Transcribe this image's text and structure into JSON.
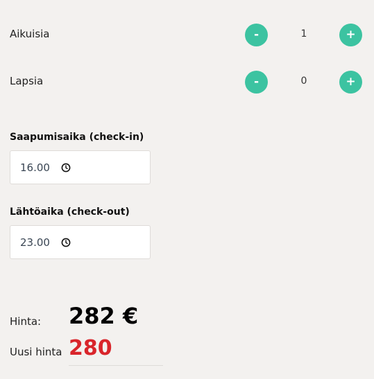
{
  "guests": {
    "adults": {
      "label": "Aikuisia",
      "value": "1",
      "minus": "-",
      "plus": "+"
    },
    "children": {
      "label": "Lapsia",
      "value": "0",
      "minus": "-",
      "plus": "+"
    }
  },
  "checkin": {
    "label": "Saapumisaika (check-in)",
    "value": "16.00",
    "icon": "clock-icon"
  },
  "checkout": {
    "label": "Lähtöaika (check-out)",
    "value": "23.00",
    "icon": "clock-icon"
  },
  "price": {
    "label": "Hinta:",
    "value": "282 €",
    "new_label": "Uusi hinta",
    "new_value": "280"
  },
  "colors": {
    "accent": "#3cc3a1",
    "new_price": "#d9252b",
    "background": "#f3f1ef"
  }
}
